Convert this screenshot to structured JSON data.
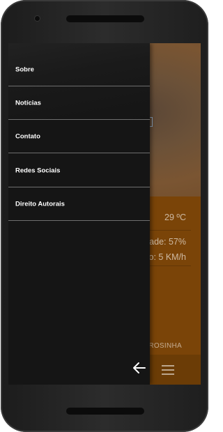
{
  "drawer": {
    "items": [
      {
        "label": "Sobre"
      },
      {
        "label": "Notícias"
      },
      {
        "label": "Contato"
      },
      {
        "label": "Redes Sociais"
      },
      {
        "label": "Direito Autorais"
      }
    ],
    "back_icon": "arrow-left-icon"
  },
  "app": {
    "temperature": "29 ºC",
    "humidity": "ade: 57%",
    "wind": "o: 5 KM/h",
    "footer_text": "ROSINHA",
    "menu_icon": "hamburger-menu-icon"
  },
  "colors": {
    "drawer_bg": "#151515",
    "app_accent": "#7a4408",
    "divider": "#6f6f6f"
  }
}
